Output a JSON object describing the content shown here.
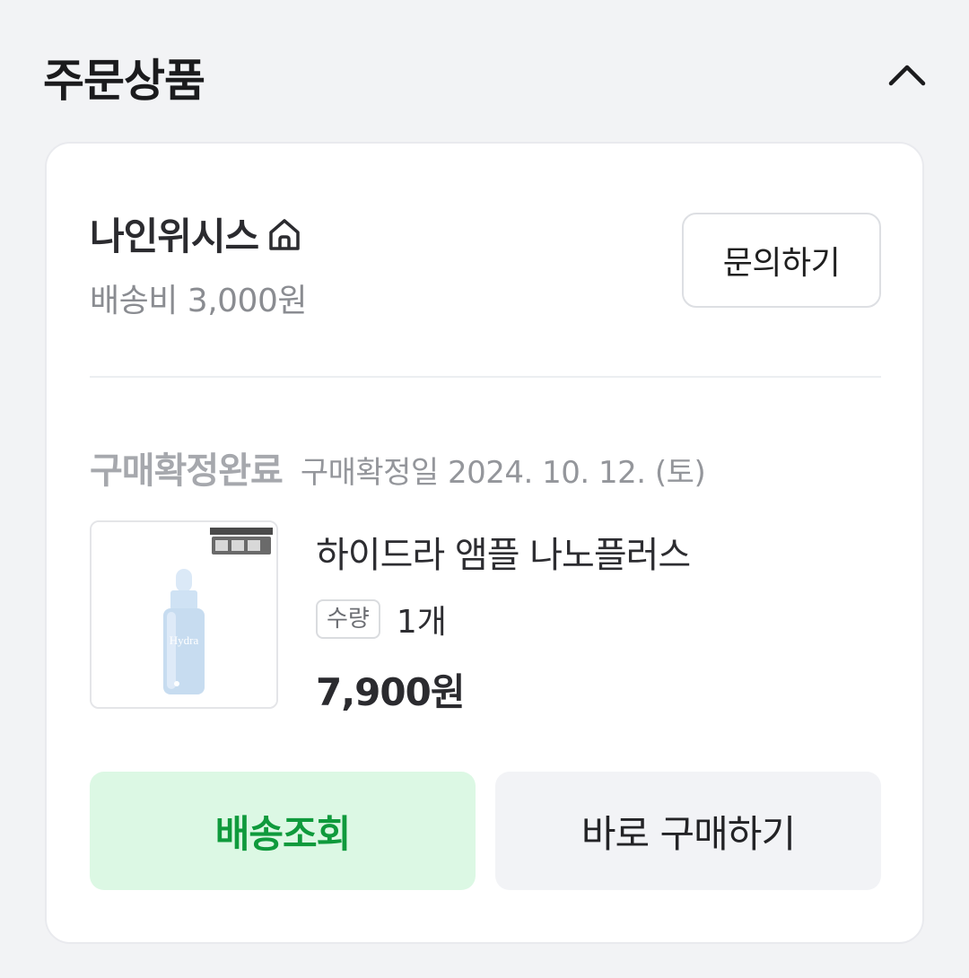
{
  "section": {
    "title": "주문상품"
  },
  "seller": {
    "name": "나인위시스",
    "shipping_fee": "배송비 3,000원",
    "inquiry_label": "문의하기"
  },
  "order": {
    "status": "구매확정완료",
    "confirm_date": "구매확정일 2024. 10. 12. (토)"
  },
  "product": {
    "name": "하이드라 앰플 나노플러스",
    "quantity_badge": "수량",
    "quantity": "1개",
    "price": "7,900원",
    "thumbnail_text": "Hydra"
  },
  "actions": {
    "track_label": "배송조회",
    "buy_again_label": "바로 구매하기"
  },
  "colors": {
    "background": "#f2f3f5",
    "card": "#ffffff",
    "accent_green": "#0f9a3c",
    "accent_green_bg": "#dcf8e4"
  },
  "icons": {
    "collapse": "chevron-up-icon",
    "store": "home-icon"
  }
}
